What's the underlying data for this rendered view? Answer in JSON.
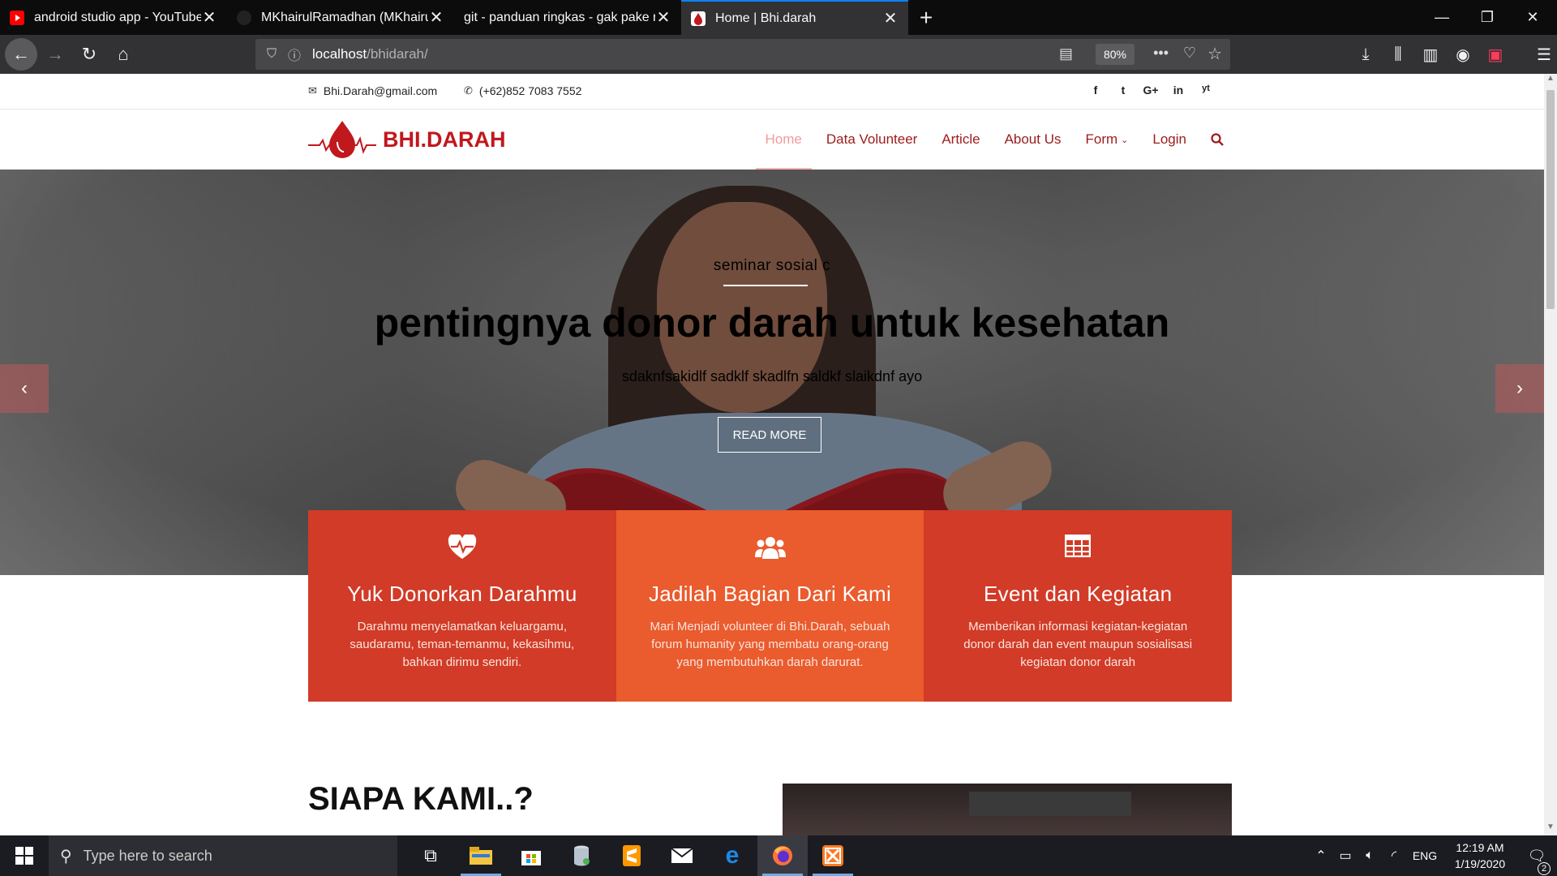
{
  "browser": {
    "tabs": [
      {
        "title": "android studio app - YouTube",
        "favicon": "youtube-icon",
        "active": false
      },
      {
        "title": "MKhairulRamadhan (MKhairulR",
        "favicon": "github-icon",
        "active": false
      },
      {
        "title": "git - panduan ringkas - gak pake ri",
        "favicon": "blank-icon",
        "active": false
      },
      {
        "title": "Home | Bhi.darah",
        "favicon": "bhidarah-icon",
        "active": true
      }
    ],
    "url_host": "localhost",
    "url_path": "/bhidarah/",
    "zoom": "80%"
  },
  "topbar": {
    "email": "Bhi.Darah@gmail.com",
    "phone": "(+62)852 7083 7552",
    "social": [
      "f",
      "t",
      "G+",
      "in",
      "yt"
    ]
  },
  "header": {
    "logo_text": "BHI.DARAH",
    "menu": [
      "Home",
      "Data Volunteer",
      "Article",
      "About Us",
      "Form",
      "Login"
    ]
  },
  "hero": {
    "eyebrow": "seminar sosial c",
    "headline": "pentingnya donor darah untuk kesehatan",
    "subline": "sdaknfsakidlf sadklf skadlfn saldkf slaikdnf ayo",
    "button": "READ MORE"
  },
  "features": [
    {
      "icon": "heartbeat-icon",
      "title": "Yuk Donorkan Darahmu",
      "desc": "Darahmu menyelamatkan keluargamu, saudaramu, teman-temanmu, kekasihmu, bahkan dirimu sendiri."
    },
    {
      "icon": "users-icon",
      "title": "Jadilah Bagian Dari Kami",
      "desc": "Mari Menjadi volunteer di Bhi.Darah, sebuah forum humanity yang membatu orang-orang yang membutuhkan darah darurat."
    },
    {
      "icon": "table-icon",
      "title": "Event dan Kegiatan",
      "desc": "Memberikan informasi kegiatan-kegiatan donor darah dan event maupun sosialisasi kegiatan donor darah"
    }
  ],
  "about_heading": "SIAPA KAMI..?",
  "taskbar": {
    "search_placeholder": "Type here to search",
    "lang": "ENG",
    "time": "12:19 AM",
    "date": "1/19/2020",
    "notifications": "2"
  },
  "colors": {
    "brand_red": "#c0181d",
    "feature_red": "#d13b27",
    "feature_orange": "#ea5b2d",
    "tab_accent": "#0a84ff"
  }
}
